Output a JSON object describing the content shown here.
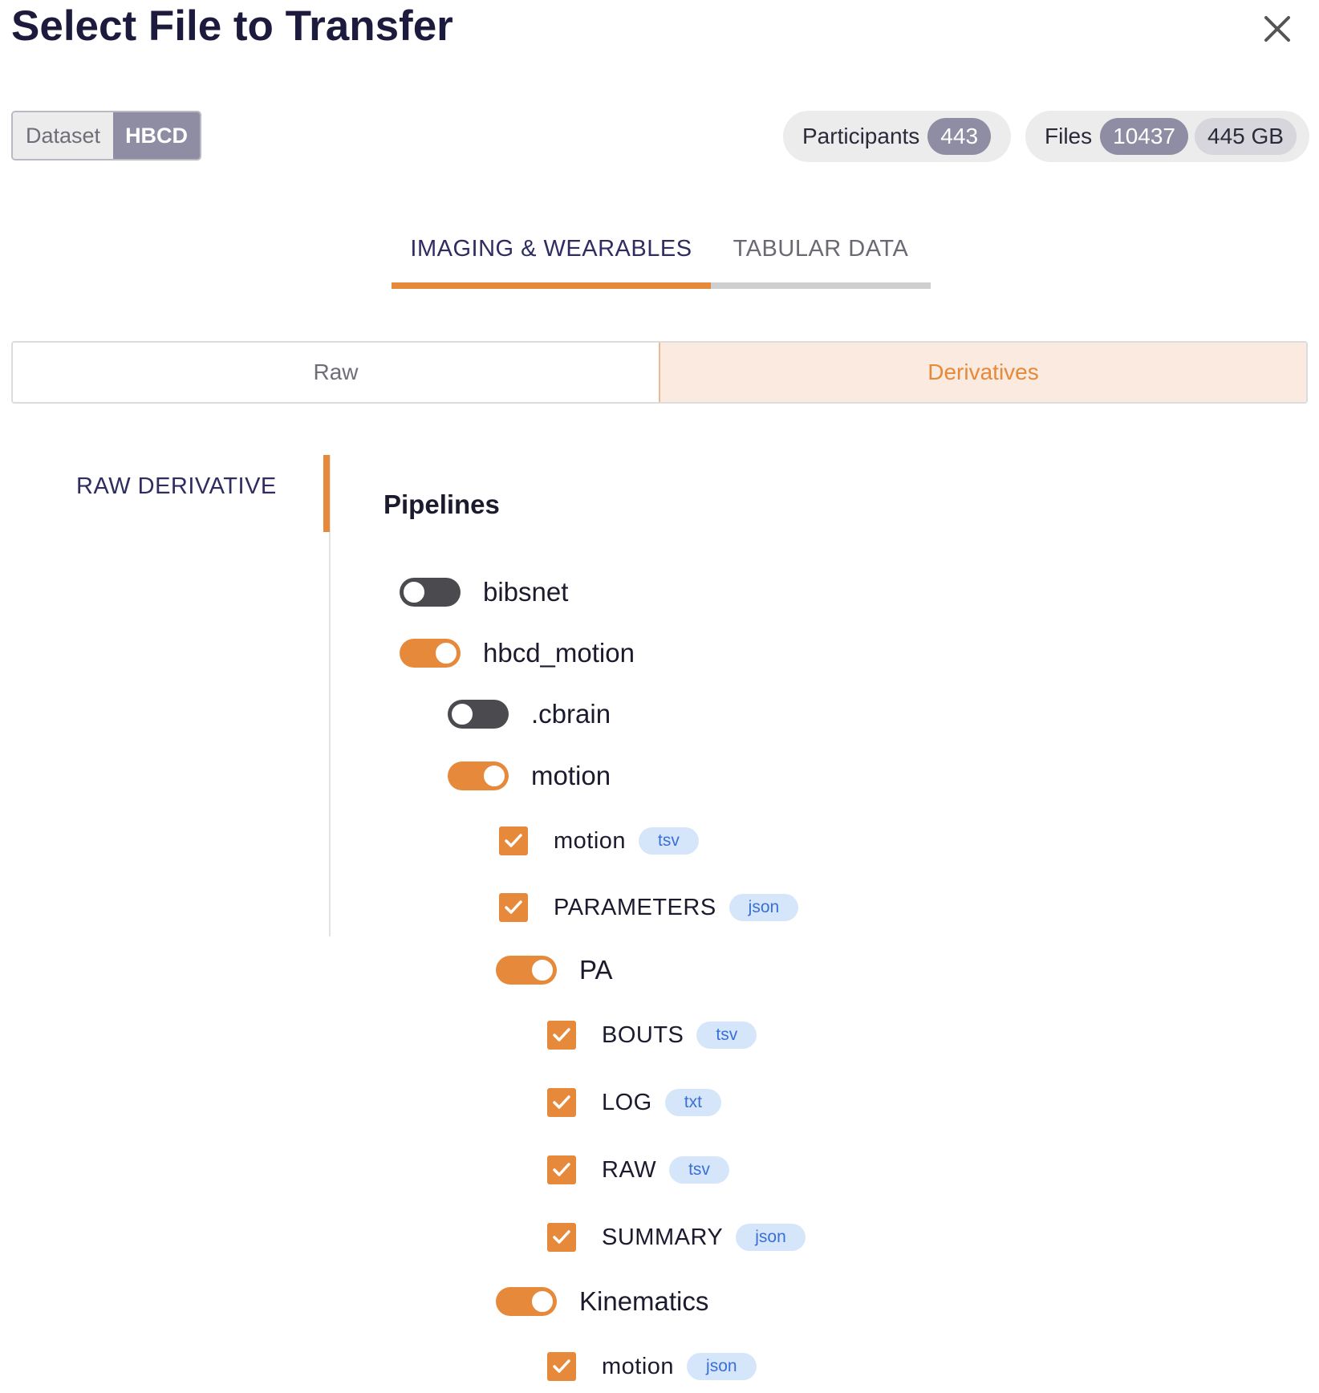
{
  "dialog": {
    "title": "Select File to Transfer"
  },
  "dataset": {
    "label": "Dataset",
    "value": "HBCD"
  },
  "stats": {
    "participants_label": "Participants",
    "participants_count": "443",
    "files_label": "Files",
    "files_count": "10437",
    "files_size": "445 GB"
  },
  "tabs": [
    {
      "label": "IMAGING & WEARABLES",
      "active": true
    },
    {
      "label": "TABULAR DATA",
      "active": false
    }
  ],
  "segment": {
    "raw": "Raw",
    "derivatives": "Derivatives",
    "selected": "Derivatives"
  },
  "sidenav": {
    "items": [
      {
        "label": "RAW DERIVATIVE",
        "active": true
      }
    ]
  },
  "section_title": "Pipelines",
  "tree": {
    "bibsnet": {
      "label": "bibsnet",
      "on": false
    },
    "hbcd_motion": {
      "label": "hbcd_motion",
      "on": true
    },
    "cbrain": {
      "label": ".cbrain",
      "on": false
    },
    "motion": {
      "label": "motion",
      "on": true
    },
    "motion_file": {
      "label": "motion",
      "ext": "tsv",
      "checked": true
    },
    "parameters_file": {
      "label": "PARAMETERS",
      "ext": "json",
      "checked": true
    },
    "pa": {
      "label": "PA",
      "on": true
    },
    "bouts_file": {
      "label": "BOUTS",
      "ext": "tsv",
      "checked": true
    },
    "log_file": {
      "label": "LOG",
      "ext": "txt",
      "checked": true
    },
    "raw_file": {
      "label": "RAW",
      "ext": "tsv",
      "checked": true
    },
    "summary_file": {
      "label": "SUMMARY",
      "ext": "json",
      "checked": true
    },
    "kinematics": {
      "label": "Kinematics",
      "on": true
    },
    "kin_motion_file": {
      "label": "motion",
      "ext": "json",
      "checked": true
    }
  },
  "colors": {
    "accent": "#e6893a",
    "navy": "#2e2c60",
    "badge": "#8f8da3",
    "ext_bg": "#d6e6fa",
    "ext_text": "#3a6fd8"
  }
}
